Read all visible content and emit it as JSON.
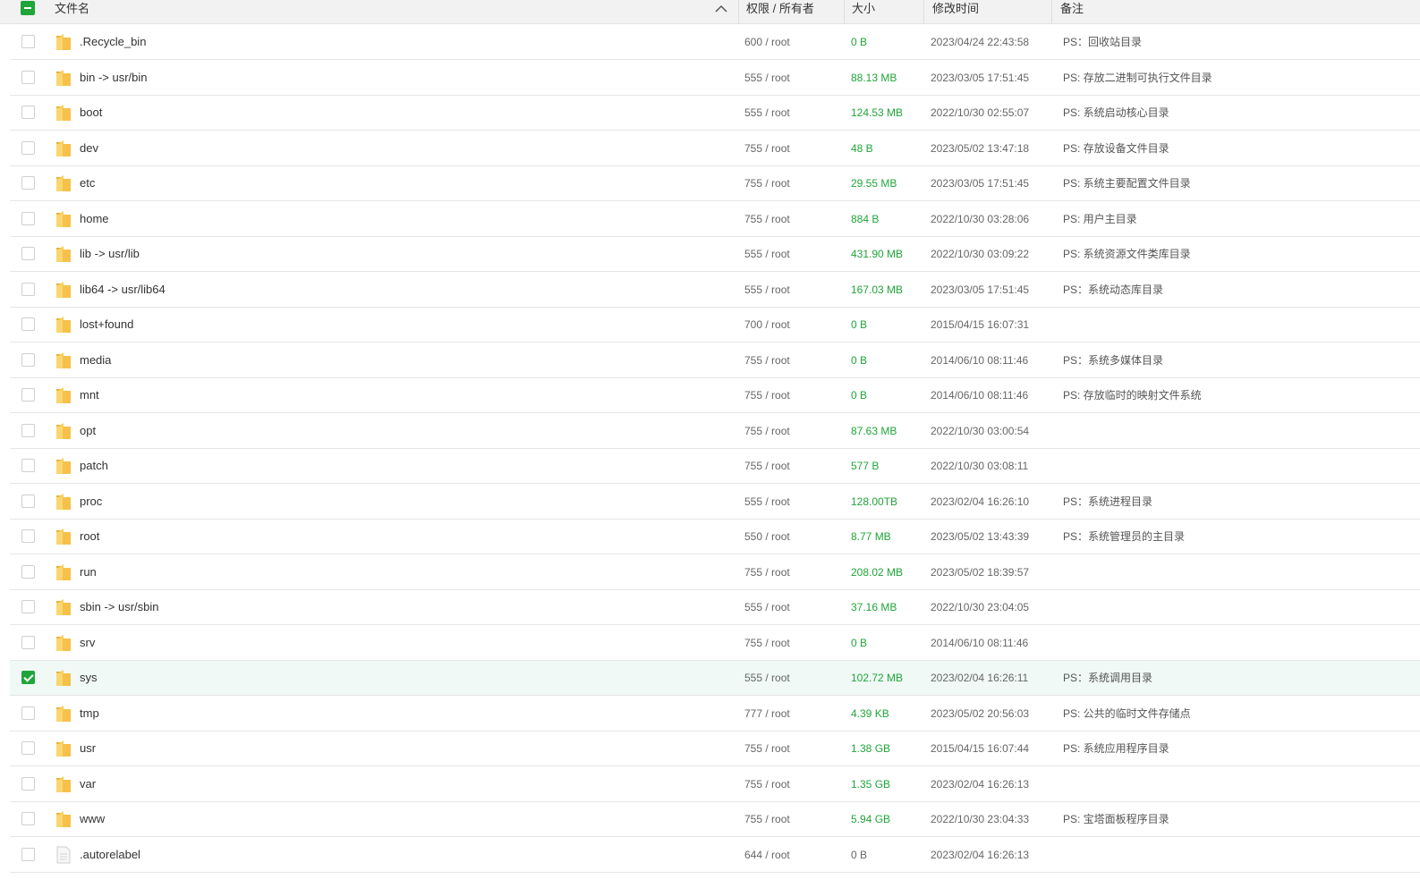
{
  "header": {
    "name": "文件名",
    "perm": "权限 / 所有者",
    "size": "大小",
    "mtime": "修改时间",
    "note": "备注"
  },
  "colors": {
    "accent": "#20a53a",
    "folder": "#f5c14b",
    "selected_row": "#f0f9f6"
  },
  "rows": [
    {
      "name": ".Recycle_bin",
      "perm": "600 / root",
      "size": "0 B",
      "mtime": "2023/04/24 22:43:58",
      "note": "PS：回收站目录",
      "checked": false,
      "type": "folder"
    },
    {
      "name": "bin -> usr/bin",
      "perm": "555 / root",
      "size": "88.13 MB",
      "mtime": "2023/03/05 17:51:45",
      "note": "PS: 存放二进制可执行文件目录",
      "checked": false,
      "type": "folder"
    },
    {
      "name": "boot",
      "perm": "555 / root",
      "size": "124.53 MB",
      "mtime": "2022/10/30 02:55:07",
      "note": "PS: 系统启动核心目录",
      "checked": false,
      "type": "folder"
    },
    {
      "name": "dev",
      "perm": "755 / root",
      "size": "48 B",
      "mtime": "2023/05/02 13:47:18",
      "note": "PS: 存放设备文件目录",
      "checked": false,
      "type": "folder"
    },
    {
      "name": "etc",
      "perm": "755 / root",
      "size": "29.55 MB",
      "mtime": "2023/03/05 17:51:45",
      "note": "PS: 系统主要配置文件目录",
      "checked": false,
      "type": "folder"
    },
    {
      "name": "home",
      "perm": "755 / root",
      "size": "884 B",
      "mtime": "2022/10/30 03:28:06",
      "note": "PS: 用户主目录",
      "checked": false,
      "type": "folder"
    },
    {
      "name": "lib -> usr/lib",
      "perm": "555 / root",
      "size": "431.90 MB",
      "mtime": "2022/10/30 03:09:22",
      "note": "PS: 系统资源文件类库目录",
      "checked": false,
      "type": "folder"
    },
    {
      "name": "lib64 -> usr/lib64",
      "perm": "555 / root",
      "size": "167.03 MB",
      "mtime": "2023/03/05 17:51:45",
      "note": "PS：系统动态库目录",
      "checked": false,
      "type": "folder"
    },
    {
      "name": "lost+found",
      "perm": "700 / root",
      "size": "0 B",
      "mtime": "2015/04/15 16:07:31",
      "note": "",
      "checked": false,
      "type": "folder"
    },
    {
      "name": "media",
      "perm": "755 / root",
      "size": "0 B",
      "mtime": "2014/06/10 08:11:46",
      "note": "PS：系统多媒体目录",
      "checked": false,
      "type": "folder"
    },
    {
      "name": "mnt",
      "perm": "755 / root",
      "size": "0 B",
      "mtime": "2014/06/10 08:11:46",
      "note": "PS: 存放临时的映射文件系统",
      "checked": false,
      "type": "folder"
    },
    {
      "name": "opt",
      "perm": "755 / root",
      "size": "87.63 MB",
      "mtime": "2022/10/30 03:00:54",
      "note": "",
      "checked": false,
      "type": "folder"
    },
    {
      "name": "patch",
      "perm": "755 / root",
      "size": "577 B",
      "mtime": "2022/10/30 03:08:11",
      "note": "",
      "checked": false,
      "type": "folder"
    },
    {
      "name": "proc",
      "perm": "555 / root",
      "size": "128.00TB",
      "mtime": "2023/02/04 16:26:10",
      "note": "PS：系统进程目录",
      "checked": false,
      "type": "folder"
    },
    {
      "name": "root",
      "perm": "550 / root",
      "size": "8.77 MB",
      "mtime": "2023/05/02 13:43:39",
      "note": "PS：系统管理员的主目录",
      "checked": false,
      "type": "folder"
    },
    {
      "name": "run",
      "perm": "755 / root",
      "size": "208.02 MB",
      "mtime": "2023/05/02 18:39:57",
      "note": "",
      "checked": false,
      "type": "folder"
    },
    {
      "name": "sbin -> usr/sbin",
      "perm": "555 / root",
      "size": "37.16 MB",
      "mtime": "2022/10/30 23:04:05",
      "note": "",
      "checked": false,
      "type": "folder"
    },
    {
      "name": "srv",
      "perm": "755 / root",
      "size": "0 B",
      "mtime": "2014/06/10 08:11:46",
      "note": "",
      "checked": false,
      "type": "folder"
    },
    {
      "name": "sys",
      "perm": "555 / root",
      "size": "102.72 MB",
      "mtime": "2023/02/04 16:26:11",
      "note": "PS：系统调用目录",
      "checked": true,
      "type": "folder"
    },
    {
      "name": "tmp",
      "perm": "777 / root",
      "size": "4.39 KB",
      "mtime": "2023/05/02 20:56:03",
      "note": "PS: 公共的临时文件存储点",
      "checked": false,
      "type": "folder"
    },
    {
      "name": "usr",
      "perm": "755 / root",
      "size": "1.38 GB",
      "mtime": "2015/04/15 16:07:44",
      "note": "PS: 系统应用程序目录",
      "checked": false,
      "type": "folder"
    },
    {
      "name": "var",
      "perm": "755 / root",
      "size": "1.35 GB",
      "mtime": "2023/02/04 16:26:13",
      "note": "",
      "checked": false,
      "type": "folder"
    },
    {
      "name": "www",
      "perm": "755 / root",
      "size": "5.94 GB",
      "mtime": "2022/10/30 23:04:33",
      "note": "PS: 宝塔面板程序目录",
      "checked": false,
      "type": "folder"
    },
    {
      "name": ".autorelabel",
      "perm": "644 / root",
      "size": "0 B",
      "mtime": "2023/02/04 16:26:13",
      "note": "",
      "checked": false,
      "type": "file"
    }
  ]
}
